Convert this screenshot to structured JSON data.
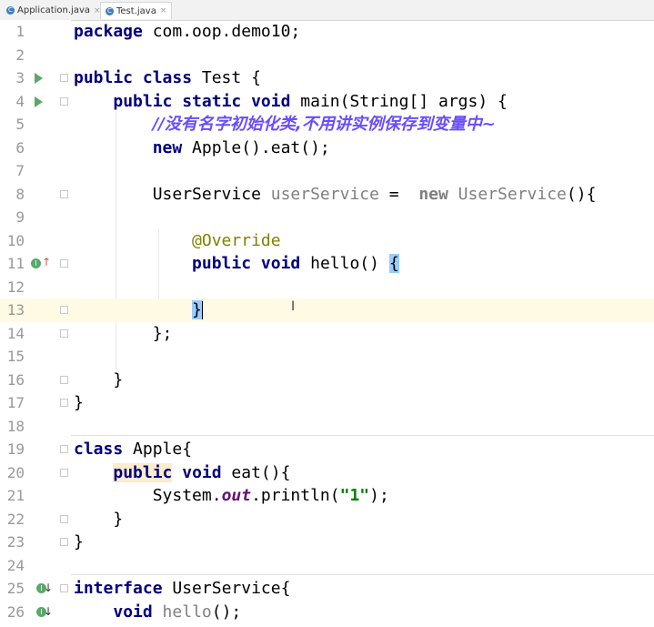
{
  "tabs": [
    {
      "label": "Application.java",
      "icon": "java-class-icon",
      "active": false
    },
    {
      "label": "Test.java",
      "icon": "java-class-icon",
      "active": true
    }
  ],
  "tab_close_glyph": "×",
  "tab_icon_letter": "C",
  "lines": {
    "1": {
      "num": "1"
    },
    "2": {
      "num": "2"
    },
    "3": {
      "num": "3"
    },
    "4": {
      "num": "4"
    },
    "5": {
      "num": "5"
    },
    "6": {
      "num": "6"
    },
    "7": {
      "num": "7"
    },
    "8": {
      "num": "8"
    },
    "9": {
      "num": "9"
    },
    "10": {
      "num": "10"
    },
    "11": {
      "num": "11"
    },
    "12": {
      "num": "12"
    },
    "13": {
      "num": "13"
    },
    "14": {
      "num": "14"
    },
    "15": {
      "num": "15"
    },
    "16": {
      "num": "16"
    },
    "17": {
      "num": "17"
    },
    "18": {
      "num": "18"
    },
    "19": {
      "num": "19"
    },
    "20": {
      "num": "20"
    },
    "21": {
      "num": "21"
    },
    "22": {
      "num": "22"
    },
    "23": {
      "num": "23"
    },
    "24": {
      "num": "24"
    },
    "25": {
      "num": "25"
    },
    "26": {
      "num": "26"
    }
  },
  "code": {
    "l1_kw": "package",
    "l1_rest": " com.oop.demo10;",
    "l3_kw": "public class",
    "l3_rest": " Test {",
    "l4_indent": "    ",
    "l4_kw": "public static void",
    "l4_rest": " main(String[] args) {",
    "l5_indent": "        ",
    "l5_comment": "//没有名字初始化类,不用讲实例保存到变量中~",
    "l6_indent": "        ",
    "l6_kw": "new",
    "l6_rest": " Apple().eat();",
    "l8_indent": "        ",
    "l8_type": "UserService ",
    "l8_var": "userService",
    "l8_eq": " =  ",
    "l8_new": "new",
    "l8_ctor": " UserService",
    "l8_rest": "(){",
    "l10_indent": "            ",
    "l10_ann": "@Override",
    "l11_indent": "            ",
    "l11_kw": "public void",
    "l11_rest": " hello() ",
    "l11_brace": "{",
    "l13_indent": "            ",
    "l13_brace": "}",
    "l14_indent": "        ",
    "l14_text": "};",
    "l16_indent": "    ",
    "l16_text": "}",
    "l17_text": "}",
    "l19_kw": "class",
    "l19_rest": " Apple{",
    "l20_indent": "    ",
    "l20_kw1": "public",
    "l20_kw2": " void",
    "l20_rest": " eat(){",
    "l21_indent": "        ",
    "l21_sys": "System.",
    "l21_out": "out",
    "l21_call": ".println(",
    "l21_str": "\"1\"",
    "l21_end": ");",
    "l22_indent": "    ",
    "l22_text": "}",
    "l23_text": "}",
    "l25_kw": "interface",
    "l25_rest": " UserService{",
    "l26_indent": "    ",
    "l26_kw": "void",
    "l26_name": " hello",
    "l26_rest": "();"
  },
  "gutter_icons": {
    "impl_letter": "I",
    "arrow_up": "↑",
    "arrow_down": "↓"
  },
  "text_cursor_glyph": "I",
  "colors": {
    "keyword": "#000080",
    "comment": "#6a4cff",
    "annotation": "#808000",
    "string": "#008000",
    "current_line": "#fffae3",
    "brace_match": "#99ccff"
  }
}
